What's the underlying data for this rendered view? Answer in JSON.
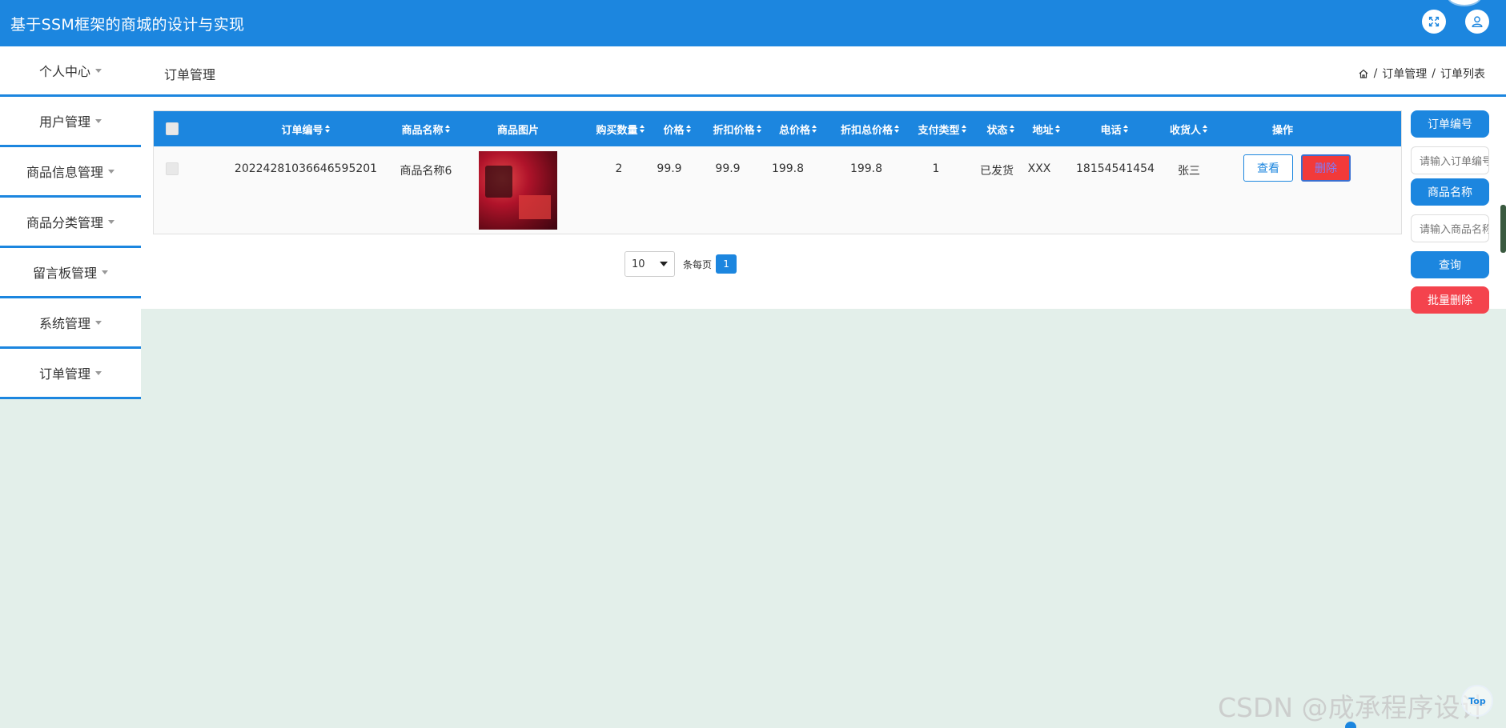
{
  "header": {
    "title": "基于SSM框架的商城的设计与实现",
    "expand_icon": "fullscreen-icon",
    "user_icon": "user-icon"
  },
  "sidebar": {
    "items": [
      {
        "label": "个人中心"
      },
      {
        "label": "用户管理"
      },
      {
        "label": "商品信息管理"
      },
      {
        "label": "商品分类管理"
      },
      {
        "label": "留言板管理"
      },
      {
        "label": "系统管理"
      },
      {
        "label": "订单管理"
      }
    ]
  },
  "page": {
    "title": "订单管理",
    "breadcrumb": [
      "订单管理",
      "订单列表"
    ]
  },
  "table": {
    "headers": [
      "订单编号",
      "商品名称",
      "商品图片",
      "购买数量",
      "价格",
      "折扣价格",
      "总价格",
      "折扣总价格",
      "支付类型",
      "状态",
      "地址",
      "电话",
      "收货人",
      "操作"
    ],
    "rows": [
      {
        "order_no": "20224281036646595201",
        "product_name": "商品名称6",
        "quantity": "2",
        "price": "99.9",
        "discount_price": "99.9",
        "total_price": "199.8",
        "discount_total": "199.8",
        "pay_type": "1",
        "status": "已发货",
        "address": "XXX",
        "phone": "18154541454",
        "receiver": "张三",
        "view_label": "查看",
        "delete_label": "删除"
      }
    ]
  },
  "pagination": {
    "page_size": "10",
    "per_page_label": "条每页",
    "current_page": "1"
  },
  "search_panel": {
    "order_no_label": "订单编号",
    "order_no_placeholder": "请输入订单编号",
    "product_name_label": "商品名称",
    "product_name_placeholder": "请输入商品名称",
    "query_label": "查询",
    "batch_delete_label": "批量删除"
  },
  "footer": {
    "watermark": "CSDN @成承程序设计",
    "top_label": "Top"
  },
  "colors": {
    "primary": "#1c86df",
    "danger": "#f4434d",
    "background": "#e3efea"
  }
}
